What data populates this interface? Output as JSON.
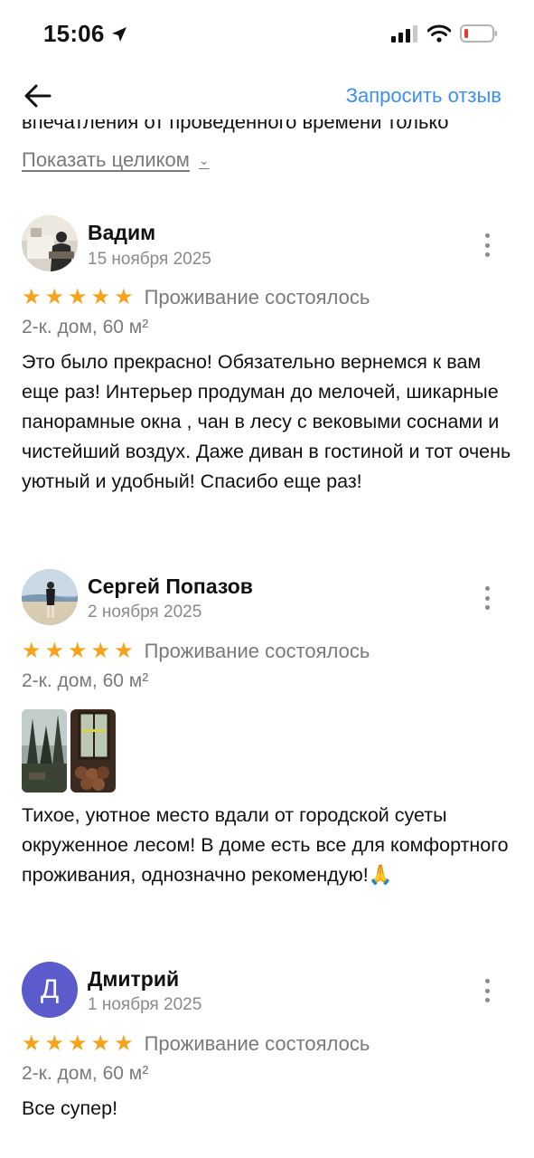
{
  "status_bar": {
    "time": "15:06"
  },
  "nav": {
    "request_review": "Запросить отзыв"
  },
  "previous_review": {
    "clipped_line": "впечатления от проведенного времени только",
    "show_full": "Показать целиком"
  },
  "reviews": [
    {
      "name": "Вадим",
      "date": "15 ноября 2025",
      "rating": 5,
      "stay_status": "Проживание состоялось",
      "room_type": "2-к. дом, 60 м²",
      "text": "Это было прекрасно! Обязательно вернемся к вам еще раз! Интерьер продуман до мелочей, шикарные панорамные окна , чан в лесу с вековыми соснами и чистейший воздух. Даже диван в гостиной и тот очень уютный и удобный! Спасибо еще раз!"
    },
    {
      "name": "Сергей Попазов",
      "date": "2 ноября 2025",
      "rating": 5,
      "stay_status": "Проживание состоялось",
      "room_type": "2-к. дом, 60 м²",
      "photo_count": 2,
      "text": "Тихое, уютное место вдали от городской суеты окруженное лесом! В доме есть все для комфортного проживания, однозначно рекомендую!🙏"
    },
    {
      "name": "Дмитрий",
      "avatar_letter": "Д",
      "avatar_color": "#5b5bcc",
      "date": "1 ноября 2025",
      "rating": 5,
      "stay_status": "Проживание состоялось",
      "room_type": "2-к. дом, 60 м²",
      "text": "Все супер!"
    }
  ],
  "colors": {
    "accent_link": "#3b8ef2",
    "star": "#f7a21b",
    "muted": "#7a7a7a"
  }
}
